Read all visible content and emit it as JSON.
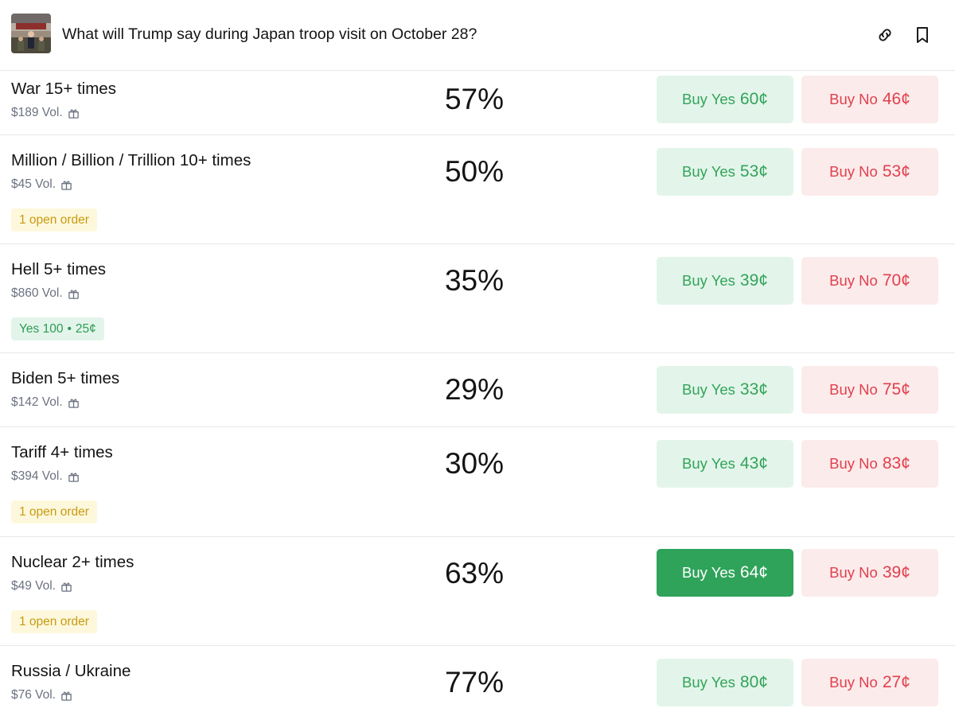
{
  "header": {
    "title": "What will Trump say during Japan troop visit on October 28?",
    "icons": [
      "link-icon",
      "bookmark-icon"
    ]
  },
  "markets": [
    {
      "name": "War 15+ times",
      "volume": "$189 Vol.",
      "chance": "57%",
      "yes_label": "Buy Yes",
      "yes_price": "60¢",
      "no_label": "Buy No",
      "no_price": "46¢"
    },
    {
      "name": "Million / Billion / Trillion 10+ times",
      "volume": "$45 Vol.",
      "chance": "50%",
      "yes_label": "Buy Yes",
      "yes_price": "53¢",
      "no_label": "Buy No",
      "no_price": "53¢",
      "badge": "1 open order"
    },
    {
      "name": "Hell 5+ times",
      "volume": "$860 Vol.",
      "chance": "35%",
      "yes_label": "Buy Yes",
      "yes_price": "39¢",
      "no_label": "Buy No",
      "no_price": "70¢",
      "position": {
        "side": "Yes",
        "shares": "100",
        "price": "25¢"
      }
    },
    {
      "name": "Biden 5+ times",
      "volume": "$142 Vol.",
      "chance": "29%",
      "yes_label": "Buy Yes",
      "yes_price": "33¢",
      "no_label": "Buy No",
      "no_price": "75¢"
    },
    {
      "name": "Tariff 4+ times",
      "volume": "$394 Vol.",
      "chance": "30%",
      "yes_label": "Buy Yes",
      "yes_price": "43¢",
      "no_label": "Buy No",
      "no_price": "83¢",
      "badge": "1 open order"
    },
    {
      "name": "Nuclear 2+ times",
      "volume": "$49 Vol.",
      "chance": "63%",
      "yes_label": "Buy Yes",
      "yes_price": "64¢",
      "no_label": "Buy No",
      "no_price": "39¢",
      "badge": "1 open order",
      "yes_selected": true
    },
    {
      "name": "Russia / Ukraine",
      "volume": "$76 Vol.",
      "chance": "77%",
      "yes_label": "Buy Yes",
      "yes_price": "80¢",
      "no_label": "Buy No",
      "no_price": "27¢"
    }
  ],
  "colors": {
    "yes_text": "#33a35a",
    "yes_bg": "#e3f5ea",
    "yes_active_bg": "#2fa35a",
    "no_text": "#e0404d",
    "no_bg": "#fcebeb",
    "order_badge_bg": "#fdf8dc",
    "order_badge_text": "#c99a12"
  }
}
